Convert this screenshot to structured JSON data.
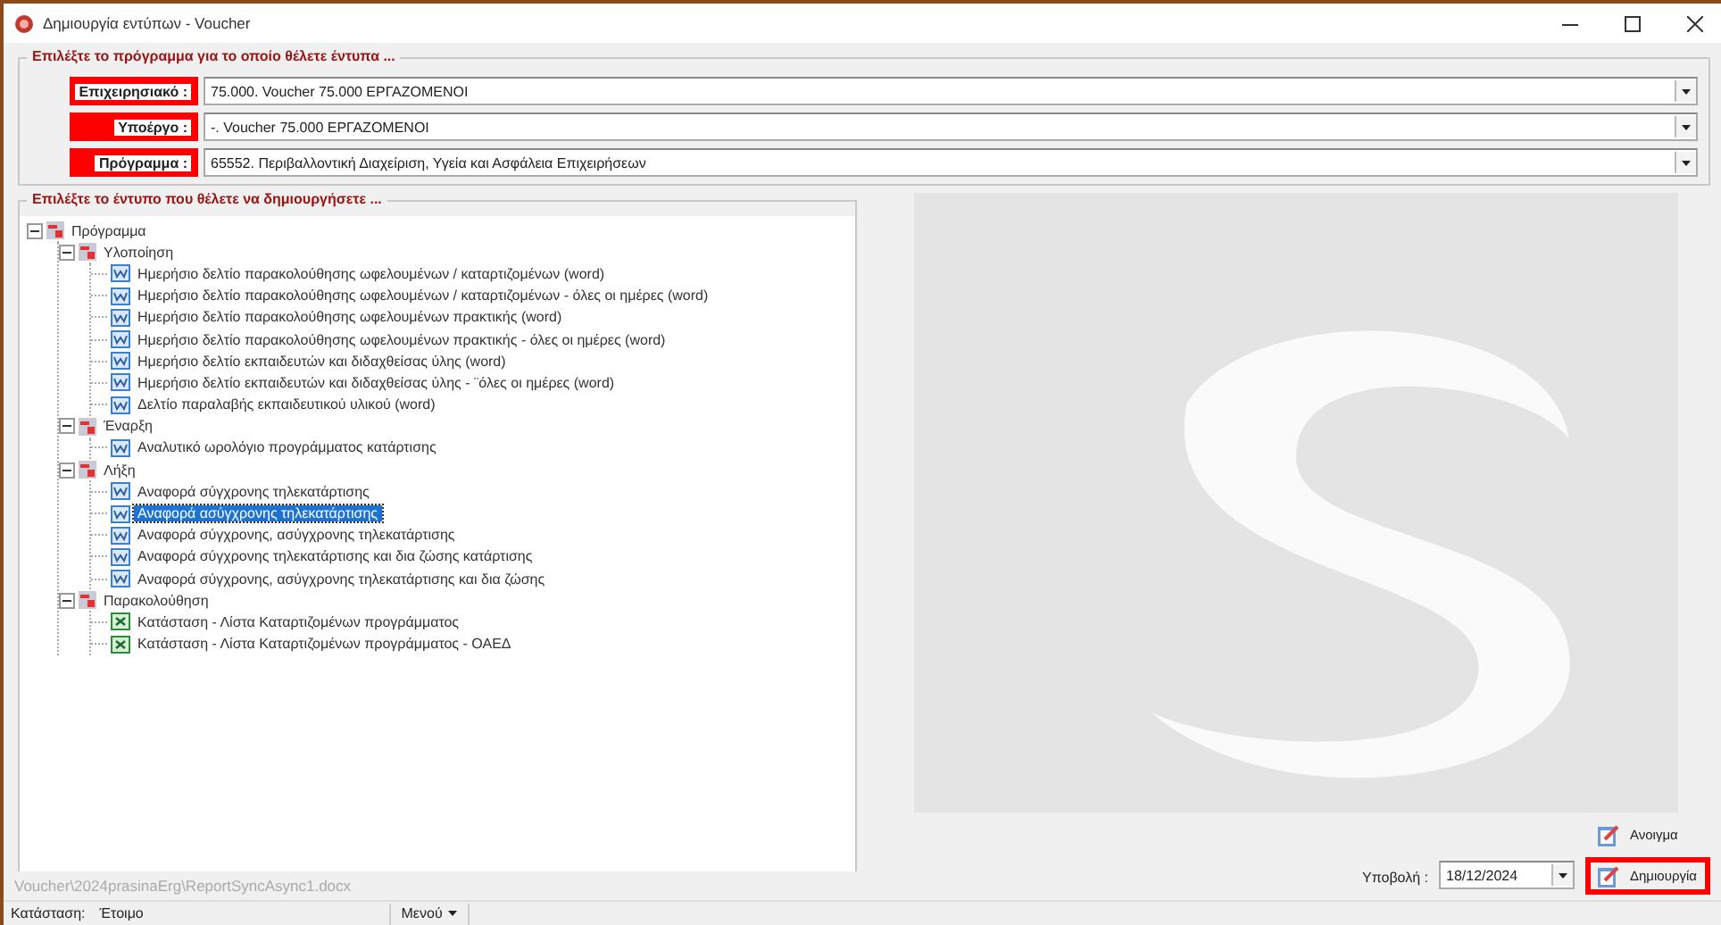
{
  "window": {
    "title": "Δημιουργία εντύπων - Voucher"
  },
  "program_group": {
    "legend": "Επιλέξτε το πρόγραμμα για το οποίο θέλετε έντυπα ...",
    "fields": [
      {
        "label": "Επιχειρησιακό :",
        "value": "75.000. Voucher 75.000 ΕΡΓΑΖΟΜΕΝΟΙ",
        "highlighted": true
      },
      {
        "label": "Υποέργο :",
        "value": "-. Voucher 75.000 ΕΡΓΑΖΟΜΕΝΟΙ",
        "highlighted": true
      },
      {
        "label": "Πρόγραμμα :",
        "value": "65552. Περιβαλλοντική Διαχείριση, Υγεία και  Ασφάλεια Επιχειρήσεων",
        "highlighted": true
      }
    ]
  },
  "form_group": {
    "legend": "Επιλέξτε το έντυπο που θέλετε να δημιουργήσετε ...",
    "tree": [
      {
        "label": "Πρόγραμμα",
        "kind": "folder",
        "expanded": true,
        "children": [
          {
            "label": "Υλοποίηση",
            "kind": "folder",
            "expanded": true,
            "children": [
              {
                "label": "Ημερήσιο δελτίο παρακολούθησης ωφελουμένων / καταρτιζομένων (word)",
                "kind": "word",
                "selected": false
              },
              {
                "label": "Ημερήσιο δελτίο παρακολούθησης ωφελουμένων / καταρτιζομένων - όλες οι ημέρες (word)",
                "kind": "word",
                "selected": false
              },
              {
                "label": "Ημερήσιο δελτίο παρακολούθησης ωφελουμένων πρακτικής (word)",
                "kind": "word",
                "selected": false
              },
              {
                "label": "Ημερήσιο δελτίο παρακολούθησης ωφελουμένων πρακτικής - όλες οι ημέρες (word)",
                "kind": "word",
                "selected": false
              },
              {
                "label": "Ημερήσιο δελτίο εκπαιδευτών και διδαχθείσας ύλης (word)",
                "kind": "word",
                "selected": false
              },
              {
                "label": "Ημερήσιο δελτίο εκπαιδευτών και διδαχθείσας ύλης - ¨όλες οι ημέρες (word)",
                "kind": "word",
                "selected": false
              },
              {
                "label": "Δελτίο παραλαβής εκπαιδευτικού υλικού (word)",
                "kind": "word",
                "selected": false
              }
            ]
          },
          {
            "label": "Έναρξη",
            "kind": "folder",
            "expanded": true,
            "children": [
              {
                "label": "Αναλυτικό ωρολόγιο προγράμματος κατάρτισης",
                "kind": "word",
                "selected": false
              }
            ]
          },
          {
            "label": "Λήξη",
            "kind": "folder",
            "expanded": true,
            "children": [
              {
                "label": "Αναφορά σύγχρονης τηλεκατάρτισης",
                "kind": "word",
                "selected": false
              },
              {
                "label": "Αναφορά ασύγχρονης τηλεκατάρτισης",
                "kind": "word",
                "selected": true
              },
              {
                "label": "Αναφορά σύγχρονης, ασύγχρονης τηλεκατάρτισης",
                "kind": "word",
                "selected": false
              },
              {
                "label": "Αναφορά σύγχρονης τηλεκατάρτισης και δια ζώσης κατάρτισης",
                "kind": "word",
                "selected": false
              },
              {
                "label": "Αναφορά σύγχρονης, ασύγχρονης τηλεκατάρτισης και δια ζώσης",
                "kind": "word",
                "selected": false
              }
            ]
          },
          {
            "label": "Παρακολούθηση",
            "kind": "folder",
            "expanded": true,
            "children": [
              {
                "label": "Κατάσταση - Λίστα Καταρτιζομένων προγράμματος",
                "kind": "excel",
                "selected": false
              },
              {
                "label": "Κατάσταση - Λίστα Καταρτιζομένων προγράμματος - ΟΑΕΔ",
                "kind": "excel",
                "selected": false
              }
            ]
          }
        ]
      }
    ]
  },
  "file_path": "Voucher\\2024prasinaErg\\ReportSyncAsync1.docx",
  "submission": {
    "label": "Υποβολή :",
    "value": "18/12/2024"
  },
  "buttons": [
    {
      "label": "Ανοιγμα",
      "highlighted": false
    },
    {
      "label": "Δημιουργία",
      "highlighted": true
    }
  ],
  "status_bar": {
    "label": "Κατάσταση:",
    "value": "Έτοιμο",
    "menu": "Μενού"
  }
}
